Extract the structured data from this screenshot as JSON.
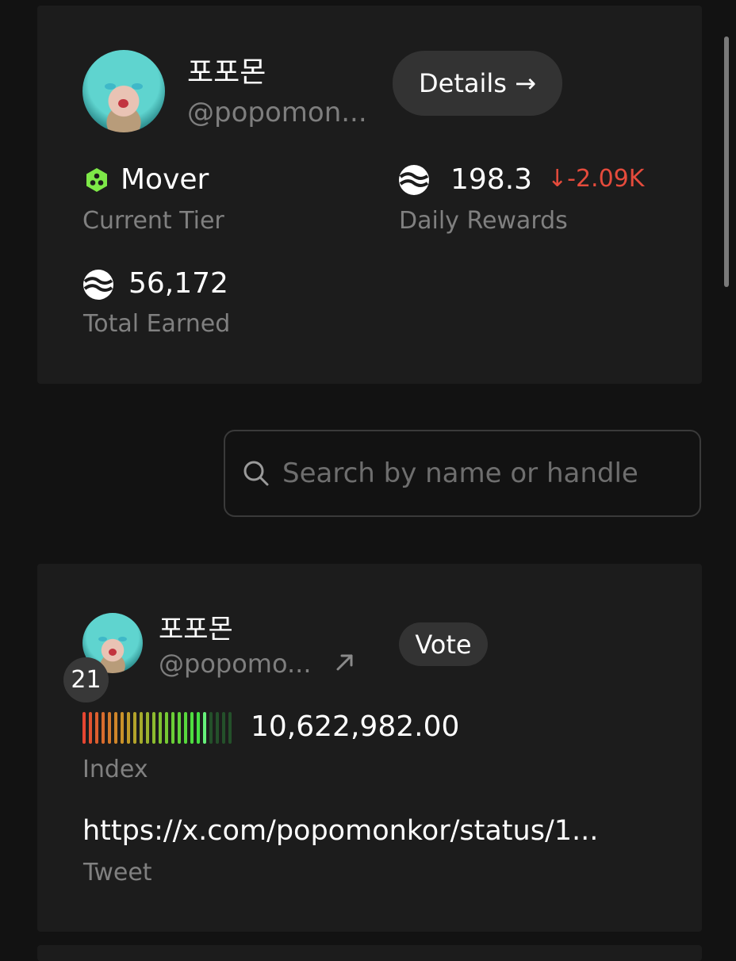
{
  "profile": {
    "name": "포포몬",
    "handle": "@popomon...",
    "details_label": "Details →",
    "tier": {
      "value": "Mover",
      "label": "Current Tier",
      "icon": "mover-tier-icon",
      "color": "#7ee848"
    },
    "daily_rewards": {
      "value": "198.3",
      "change": "↓-2.09K",
      "label": "Daily Rewards",
      "change_color": "#e54b3c"
    },
    "total_earned": {
      "value": "56,172",
      "label": "Total Earned"
    }
  },
  "search": {
    "placeholder": "Search by name or handle",
    "value": ""
  },
  "entry": {
    "name": "포포몬",
    "handle": "@popomo...",
    "rank": "21",
    "vote_label": "Vote",
    "index": {
      "value": "10,622,982.00",
      "label": "Index",
      "level": 0.82
    },
    "tweet": {
      "value": "https://x.com/popomonkor/status/1...",
      "label": "Tweet"
    }
  }
}
